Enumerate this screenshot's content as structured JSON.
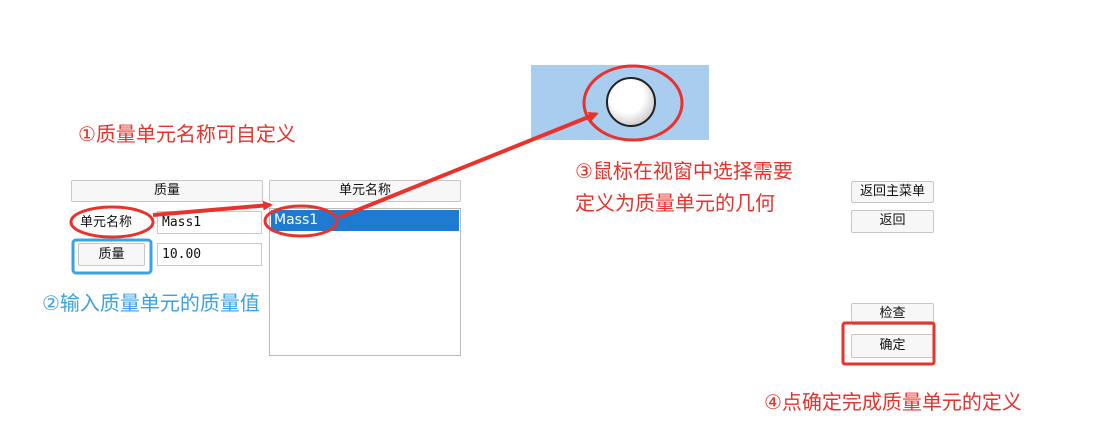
{
  "left_panel": {
    "header_button": "质量",
    "name_label": "单元名称",
    "name_value": "Mass1",
    "mass_button": "质量",
    "mass_value": "10.00"
  },
  "list_panel": {
    "header_button": "单元名称",
    "items": [
      "Mass1"
    ],
    "selected_index": 0
  },
  "right_buttons": {
    "main_menu": "返回主菜单",
    "back": "返回",
    "check": "检查",
    "confirm": "确定"
  },
  "annotations": {
    "step1": "①质量单元名称可自定义",
    "step2": "②输入质量单元的质量值",
    "step3_line1": "③鼠标在视窗中选择需要",
    "step3_line2": "定义为质量单元的几何",
    "step4": "④点确定完成质量单元的定义"
  },
  "colors": {
    "annotation_red": "#e8322b",
    "annotation_blue": "#3aa2e4",
    "selection": "#1f7ad1",
    "viewport_bg": "#a8cdee"
  }
}
